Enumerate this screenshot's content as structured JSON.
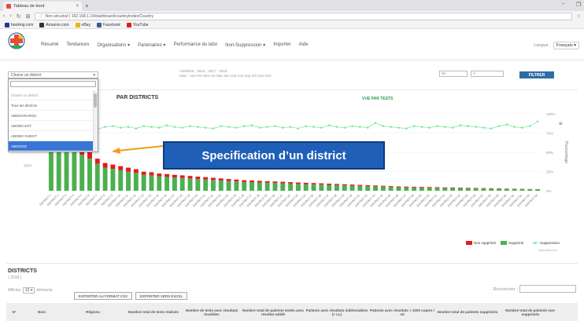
{
  "browser": {
    "tab_title": "Tableau de bord",
    "tab_close": "×",
    "new_tab": "+",
    "url": "Non sécurisé | 192.168.1.10/dashboard/country/index/Country",
    "bookmarks": [
      {
        "label": "booking.com",
        "color": "#1a3e8c"
      },
      {
        "label": "Amazon.com",
        "color": "#333"
      },
      {
        "label": "eBay",
        "color": "#e6b800"
      },
      {
        "label": "Facebook",
        "color": "#3b5998"
      },
      {
        "label": "YouTube",
        "color": "#e62117"
      }
    ]
  },
  "nav": {
    "items": [
      "Résumé",
      "Tendances",
      "Organisations ▾",
      "Partenaires ▾",
      "Performance du labo",
      "Non-Suppression ▾",
      "Importer",
      "Aide"
    ],
    "lang_label": "Langue :",
    "lang_value": "Français"
  },
  "filters": {
    "district_placeholder": "Choisir un district",
    "year_line1": "ANNÉES : 2016 · 2017 · 2018",
    "year_line2": "Mois : Jan Fév Mar Avr Mai Juin Juil Aoû Sep Oct Nov Déc",
    "date_from": "De",
    "date_to": "À",
    "filter_button": "FILTRER"
  },
  "dropdown": {
    "items": [
      "Choisir un district",
      "Tous les districts",
      "ABENGOUROU",
      "ABOBO EST",
      "ABOBO OUEST",
      "ABOISSO"
    ],
    "selected_index": 5
  },
  "chart": {
    "panel_title": "PAR DISTRICTS",
    "tests_link": "VUE PAR TESTS",
    "y_right_label": "Pourcentage",
    "y_left_ticks": [
      "1000",
      "2500"
    ],
    "y_right_ticks": [
      "100%",
      "75%",
      "50%",
      "25%",
      "0%"
    ],
    "legend": [
      {
        "label": "Non supprimé",
        "color": "#e41a1c"
      },
      {
        "label": "Supprimé",
        "color": "#4caf50"
      },
      {
        "label": "Suppression",
        "color": "#7ee8a0"
      }
    ],
    "credit": "Highcharts.com",
    "callout": "Specification d’un district"
  },
  "chart_data": {
    "type": "bar",
    "stacked": true,
    "categories": [
      "DISTRICT 1",
      "DISTRICT 2",
      "DISTRICT 3",
      "DISTRICT 4",
      "DISTRICT 5",
      "DISTRICT 6",
      "DISTRICT 7",
      "DISTRICT 8",
      "DISTRICT 9",
      "DISTRICT 10",
      "DISTRICT 11",
      "DISTRICT 12",
      "DISTRICT 13",
      "DISTRICT 14",
      "DISTRICT 15",
      "DISTRICT 16",
      "DISTRICT 17",
      "DISTRICT 18",
      "DISTRICT 19",
      "DISTRICT 20",
      "DISTRICT 21",
      "DISTRICT 22",
      "DISTRICT 23",
      "DISTRICT 24",
      "DISTRICT 25",
      "DISTRICT 26",
      "DISTRICT 27",
      "DISTRICT 28",
      "DISTRICT 29",
      "DISTRICT 30",
      "DISTRICT 31",
      "DISTRICT 32",
      "DISTRICT 33",
      "DISTRICT 34",
      "DISTRICT 35",
      "DISTRICT 36",
      "DISTRICT 37",
      "DISTRICT 38",
      "DISTRICT 39",
      "DISTRICT 40",
      "DISTRICT 41",
      "DISTRICT 42",
      "DISTRICT 43",
      "DISTRICT 44",
      "DISTRICT 45",
      "DISTRICT 46",
      "DISTRICT 47",
      "DISTRICT 48",
      "DISTRICT 49",
      "DISTRICT 50",
      "DISTRICT 51",
      "DISTRICT 52",
      "DISTRICT 53",
      "DISTRICT 54",
      "DISTRICT 55",
      "DISTRICT 56",
      "DISTRICT 57",
      "DISTRICT 58",
      "DISTRICT 59",
      "DISTRICT 60",
      "DISTRICT 61",
      "DISTRICT 62",
      "DISTRICT 63",
      "DISTRICT 64"
    ],
    "series": [
      {
        "name": "Supprimé",
        "values": [
          2200,
          2000,
          1800,
          1600,
          1400,
          1250,
          1050,
          900,
          850,
          800,
          750,
          700,
          620,
          600,
          560,
          540,
          520,
          500,
          480,
          460,
          440,
          420,
          400,
          380,
          360,
          340,
          330,
          320,
          310,
          300,
          290,
          280,
          270,
          260,
          250,
          240,
          230,
          220,
          210,
          200,
          190,
          180,
          170,
          160,
          150,
          140,
          135,
          130,
          125,
          120,
          115,
          110,
          105,
          100,
          95,
          90,
          85,
          80,
          75,
          70,
          65,
          60,
          55,
          50
        ]
      },
      {
        "name": "Non supprimé",
        "values": [
          400,
          380,
          340,
          300,
          280,
          250,
          200,
          180,
          170,
          160,
          150,
          140,
          120,
          120,
          110,
          110,
          100,
          100,
          95,
          90,
          90,
          85,
          80,
          78,
          75,
          70,
          68,
          65,
          62,
          60,
          58,
          55,
          52,
          50,
          50,
          48,
          46,
          44,
          42,
          40,
          38,
          36,
          34,
          32,
          30,
          28,
          27,
          26,
          25,
          24,
          23,
          22,
          21,
          20,
          19,
          18,
          17,
          16,
          15,
          14,
          13,
          12,
          11,
          10
        ]
      },
      {
        "name": "Suppression",
        "values": [
          80,
          82,
          81,
          84,
          82,
          85,
          80,
          83,
          84,
          82,
          83,
          81,
          84,
          83,
          82,
          85,
          83,
          82,
          84,
          83,
          82,
          81,
          84,
          83,
          82,
          84,
          85,
          82,
          83,
          84,
          82,
          83,
          81,
          84,
          83,
          82,
          85,
          83,
          82,
          84,
          83,
          82,
          88,
          84,
          83,
          82,
          81,
          84,
          83,
          82,
          84,
          83,
          82,
          85,
          84,
          83,
          82,
          81,
          84,
          86,
          83,
          82,
          84,
          90
        ]
      }
    ],
    "ylim": [
      0,
      3000
    ],
    "y2lim": [
      0,
      100
    ]
  },
  "districts": {
    "title": "DISTRICTS",
    "year": "( 2018 )",
    "length_prefix": "Afficher",
    "length_value": "10",
    "length_suffix": "éléments",
    "export_csv": "EXPORTER AU FORMAT CSV",
    "export_excel": "EXPORTER VERS EXCEL",
    "search_label": "Rechercher :",
    "columns": [
      "N°",
      "Nom",
      "Régions",
      "Nombre total de tests réalisés",
      "Nombre de tests avec résultats invalides",
      "Nombre total de patients testés avec résultat validé",
      "Patients avec résultats indétectables (< LL)",
      "Patients avec résultats < 1000 copies / ml",
      "Nombre total de patients supprimés",
      "Nombre total de patients non-supprimés"
    ]
  }
}
